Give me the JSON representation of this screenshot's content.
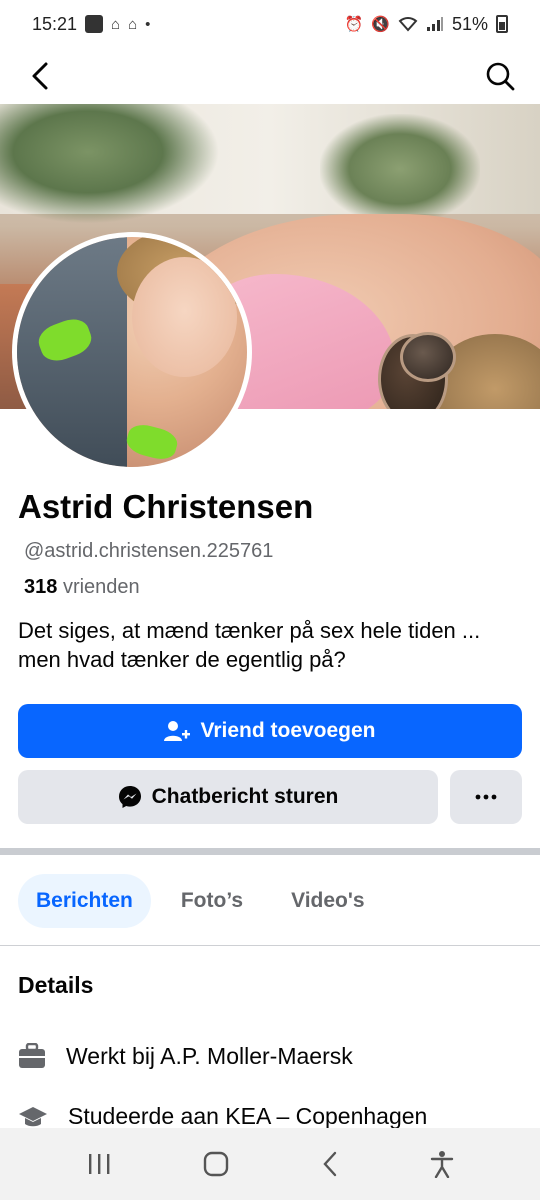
{
  "status_bar": {
    "time": "15:21",
    "battery": "51%",
    "icons_left": [
      "notification-icon",
      "app-icon",
      "app-icon",
      "dot-icon"
    ],
    "icons_right": [
      "alarm-icon",
      "mute-icon",
      "wifi-icon",
      "signal-icon",
      "battery-icon"
    ]
  },
  "topbar": {
    "back_icon": "back-chevron-icon",
    "search_icon": "search-icon"
  },
  "profile": {
    "name": "Astrid Christensen",
    "handle": "@astrid.christensen.225761",
    "friends_count": "318",
    "friends_label": "vrienden",
    "bio": "Det siges, at mænd tænker på sex hele tiden ... men hvad tænker de egentlig på?"
  },
  "actions": {
    "add_friend_label": "Vriend toevoegen",
    "message_label": "Chatbericht sturen",
    "more_label": "···"
  },
  "tabs": [
    {
      "label": "Berichten",
      "active": true
    },
    {
      "label": "Foto’s",
      "active": false
    },
    {
      "label": "Video's",
      "active": false
    }
  ],
  "details": {
    "title": "Details",
    "items": [
      {
        "icon": "briefcase-icon",
        "text": "Werkt bij A.P. Moller-Maersk"
      },
      {
        "icon": "graduation-cap-icon",
        "text": "Studeerde aan KEA – Copenhagen"
      }
    ]
  },
  "colors": {
    "primary": "#0866ff",
    "secondary_bg": "#e4e6eb",
    "tab_active_bg": "#ebf5ff",
    "muted_text": "#65676b"
  }
}
